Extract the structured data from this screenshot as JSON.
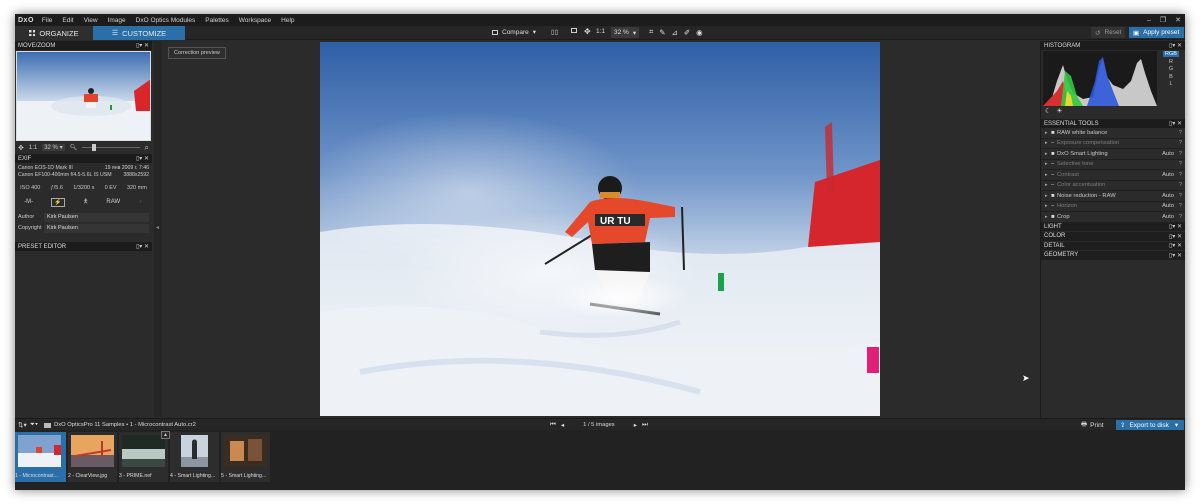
{
  "app": {
    "logo": "DxO"
  },
  "menu": [
    "File",
    "Edit",
    "View",
    "Image",
    "DxO Optics Modules",
    "Palettes",
    "Workspace",
    "Help"
  ],
  "window_controls": [
    "–",
    "❐",
    "✕"
  ],
  "tabs": {
    "organize": "ORGANIZE",
    "customize": "CUSTOMIZE"
  },
  "toolbar": {
    "compare": "Compare",
    "ratio": "1:1",
    "zoom": "32 %",
    "reset": "Reset",
    "apply_preset": "Apply preset"
  },
  "left": {
    "movezoom_title": "MOVE/ZOOM",
    "movezoom_ratio": "1:1",
    "movezoom_zoom": "32 %",
    "exif_title": "EXIF",
    "exif_rows": [
      {
        "l": "Canon EOS-1D Mark III",
        "r": "19 янв 2009 г. 7:46"
      },
      {
        "l": "Canon EF100-400mm f/4.5-5.6L IS USM",
        "r": "3888x2592"
      }
    ],
    "exposure": [
      "ISO 400",
      "ƒ/5.6",
      "1/3200 s",
      "0 EV",
      "320 mm"
    ],
    "mode": "-M-",
    "raw": "RAW",
    "author_label": "Author",
    "author": "Kirk Paulsen",
    "copyright_label": "Copyright",
    "copyright": "Kirk Paulsen",
    "preset_title": "PRESET EDITOR"
  },
  "center": {
    "correction_preview": "Correction preview"
  },
  "right": {
    "histogram_title": "HISTOGRAM",
    "channels": [
      "RGB",
      "R",
      "G",
      "B",
      "L"
    ],
    "essential_title": "ESSENTIAL TOOLS",
    "tools": [
      {
        "name": "RAW white balance",
        "value": "",
        "q": "?",
        "checked": true,
        "dim": false
      },
      {
        "name": "Exposure compensation",
        "value": "",
        "q": "?",
        "checked": false,
        "dim": true
      },
      {
        "name": "DxO Smart Lighting",
        "value": "Auto",
        "q": "?",
        "checked": true,
        "dim": false
      },
      {
        "name": "Selective tone",
        "value": "",
        "q": "?",
        "checked": false,
        "dim": true
      },
      {
        "name": "Contrast",
        "value": "Auto",
        "q": "?",
        "checked": false,
        "dim": true
      },
      {
        "name": "Color accentuation",
        "value": "",
        "q": "?",
        "checked": false,
        "dim": true
      },
      {
        "name": "Noise reduction - RAW",
        "value": "Auto",
        "q": "?",
        "checked": true,
        "dim": false
      },
      {
        "name": "Horizon",
        "value": "Auto",
        "q": "?",
        "checked": false,
        "dim": true
      },
      {
        "name": "Crop",
        "value": "Auto",
        "q": "?",
        "checked": true,
        "dim": false
      }
    ],
    "sections": [
      "LIGHT",
      "COLOR",
      "DETAIL",
      "GEOMETRY"
    ]
  },
  "filmstrip": {
    "path": "DxO OpticsPro 11 Samples  •  1 - Microcontrast Auto.cr2",
    "counter": "1 / 5  images",
    "print": "Print",
    "export": "Export to disk",
    "items": [
      "1 - Microcontrast...",
      "2 - ClearView.jpg",
      "3 - PRIME.nef",
      "4 - Smart Lighting...",
      "5 - Smart Lighting..."
    ]
  },
  "colors": {
    "accent": "#2a6fa8",
    "panel": "#2b2b2b",
    "header": "#1c1c1c"
  }
}
